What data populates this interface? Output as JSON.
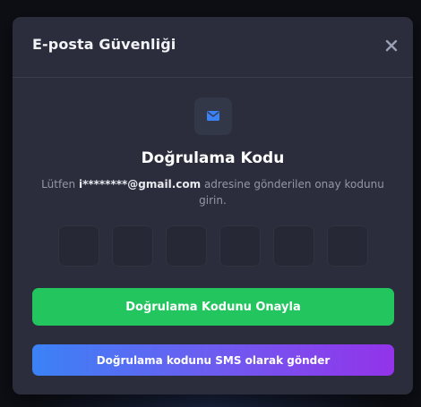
{
  "modal": {
    "title": "E-posta Güvenliği",
    "close_icon": "close-icon"
  },
  "verification": {
    "icon": "envelope-icon",
    "heading": "Doğrulama Kodu",
    "description_prefix": "Lütfen ",
    "email": "i********@gmail.com",
    "description_suffix": " adresine gönderilen onay kodunu girin.",
    "code_digits": [
      "",
      "",
      "",
      "",
      "",
      ""
    ]
  },
  "actions": {
    "verify_label": "Doğrulama Kodunu Onayla",
    "sms_label": "Doğrulama kodunu SMS olarak gönder"
  },
  "colors": {
    "accent_green": "#22c55e",
    "sms_gradient_start": "#3b82f6",
    "sms_gradient_end": "#9333ea",
    "mail_icon": "#3b82f6"
  }
}
